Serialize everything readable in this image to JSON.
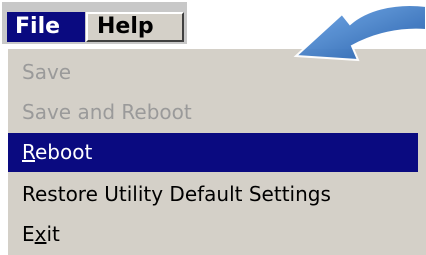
{
  "menubar": {
    "items": [
      {
        "label": "File"
      },
      {
        "label": "Help"
      }
    ]
  },
  "file_menu": {
    "items": [
      {
        "label": "Save",
        "enabled": false
      },
      {
        "label": "Save and Reboot",
        "enabled": false
      },
      {
        "label_mnemonic": "R",
        "label_rest": "eboot",
        "enabled": true,
        "selected": true
      },
      {
        "label": "Restore Utility Default Settings",
        "enabled": true
      },
      {
        "label_pre": "E",
        "label_mnemonic": "x",
        "label_rest": "it",
        "enabled": true
      }
    ]
  },
  "colors": {
    "highlight": "#0a0a80",
    "menu_bg": "#d4d0c8",
    "disabled_text": "#9a9a9a",
    "arrow": "#3a78c8"
  },
  "icons": {
    "pointer_arrow": "curved-arrow-icon"
  }
}
